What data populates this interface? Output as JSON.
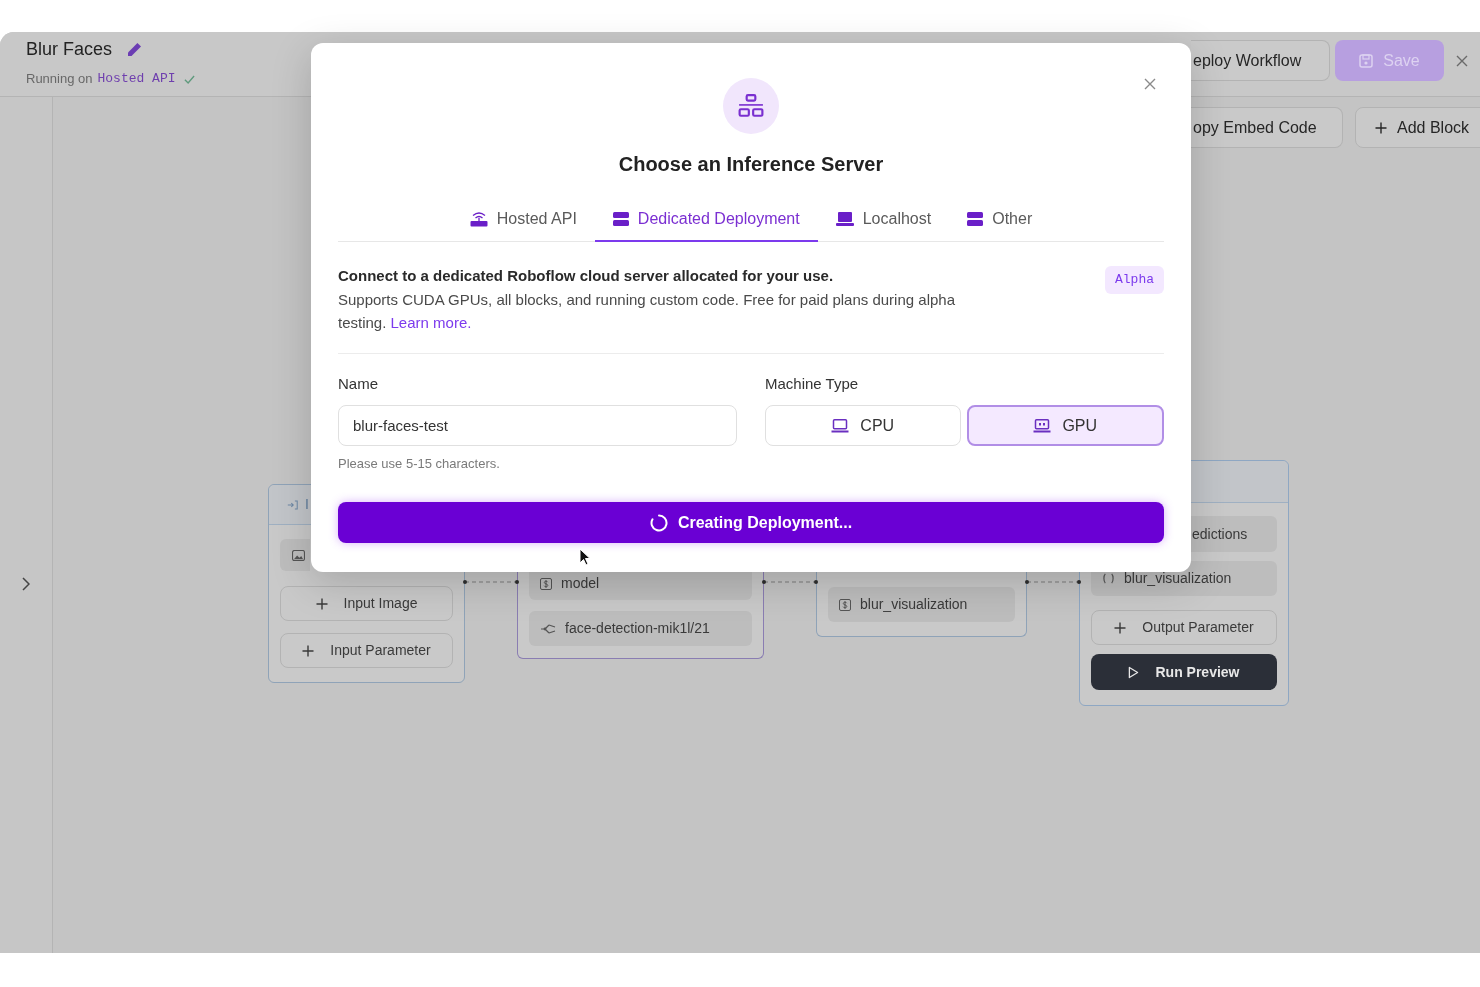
{
  "header": {
    "title": "Blur Faces",
    "status_label": "Running on",
    "server": "Hosted API",
    "actions": [
      {
        "kind": "outline",
        "label": "eploy Workflow",
        "disabled": false
      },
      {
        "kind": "primary",
        "label": "Save",
        "disabled": true
      }
    ]
  },
  "toolbar": [
    {
      "kind": "plain",
      "label": "opy Embed Code"
    },
    {
      "kind": "add",
      "label": "Add Block"
    }
  ],
  "canvas": {
    "nodes": [
      {
        "kind": "input",
        "title": "I",
        "rows": [
          {
            "kind": "image"
          },
          {
            "kind": "add",
            "label": "Input Image"
          },
          {
            "kind": "add",
            "label": "Input Parameter"
          }
        ]
      },
      {
        "kind": "model",
        "rows": [
          {
            "kind": "param",
            "label": "model"
          },
          {
            "kind": "model",
            "label": "face-detection-mik1l/21"
          }
        ]
      },
      {
        "kind": "visualization",
        "rows": [
          {
            "kind": "param",
            "label": "blur_visualization"
          }
        ]
      },
      {
        "kind": "output",
        "rows": [
          {
            "kind": "plain",
            "label": "edictions"
          },
          {
            "kind": "output",
            "label": "blur_visualization"
          },
          {
            "kind": "add",
            "label": "Output Parameter"
          },
          {
            "kind": "run",
            "label": "Run Preview"
          }
        ]
      }
    ]
  },
  "modal": {
    "title": "Choose an Inference Server",
    "tabs": [
      {
        "kind": "hosted",
        "label": "Hosted API",
        "selected": false
      },
      {
        "kind": "dedicated",
        "label": "Dedicated Deployment",
        "selected": true
      },
      {
        "kind": "localhost",
        "label": "Localhost",
        "selected": false
      },
      {
        "kind": "other",
        "label": "Other",
        "selected": false
      }
    ],
    "heading": "Connect to a dedicated Roboflow cloud server allocated for your use.",
    "body": "Supports CUDA GPUs, all blocks, and running custom code. Free for paid plans during alpha testing.",
    "link": "Learn more.",
    "badge": "Alpha",
    "form": {
      "name": {
        "label": "Name",
        "value": "blur-faces-test",
        "hint": "Please use 5-15 characters."
      },
      "machine_type": {
        "label": "Machine Type",
        "options": [
          {
            "kind": "cpu",
            "label": "CPU",
            "selected": false
          },
          {
            "kind": "gpu",
            "label": "GPU",
            "selected": true
          }
        ]
      }
    },
    "submit": {
      "label": "Creating Deployment...",
      "loading": true
    }
  }
}
